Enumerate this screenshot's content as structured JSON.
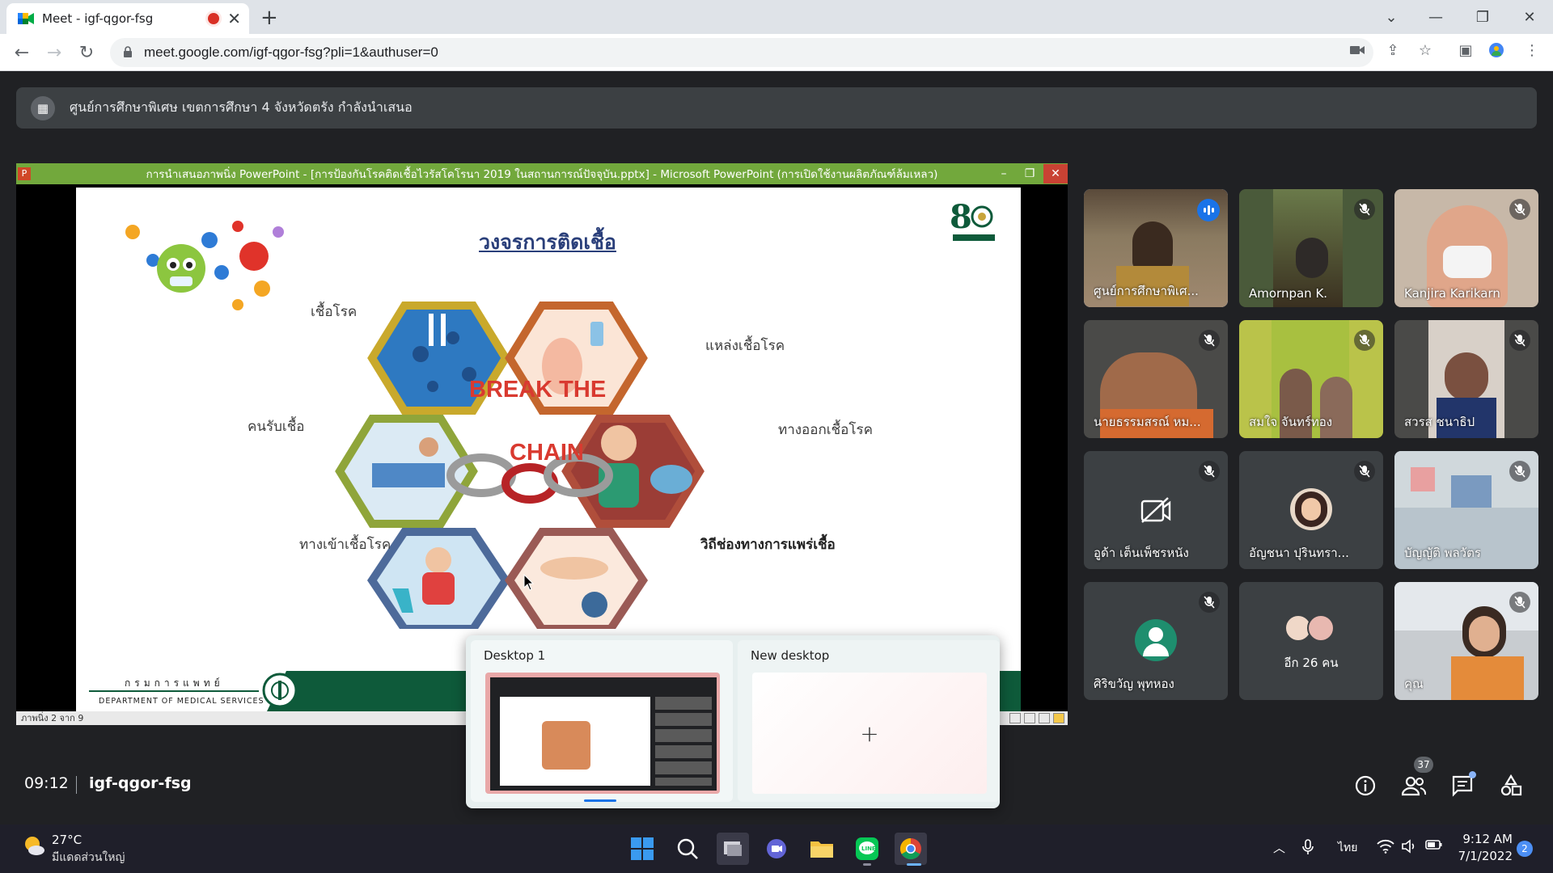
{
  "browser": {
    "tab_title": "Meet - igf-qgor-fsg",
    "url": "meet.google.com/igf-qgor-fsg?pli=1&authuser=0"
  },
  "meet": {
    "presenting_text": "ศูนย์การศึกษาพิเศษ เขตการศึกษา 4 จังหวัดตรัง กำลังนำเสนอ",
    "time": "09:12",
    "meeting_code": "igf-qgor-fsg",
    "participant_count": "37",
    "participants": [
      {
        "name": "ศูนย์การศึกษาพิเศ...",
        "muted": false,
        "speaking": true
      },
      {
        "name": "Amornpan K.",
        "muted": true
      },
      {
        "name": "Kanjira Karikarn",
        "muted": true
      },
      {
        "name": "นายธรรมสรณ์ หม...",
        "muted": true
      },
      {
        "name": "สมใจ จันทร์ทอง",
        "muted": true
      },
      {
        "name": "สวรส ชนาธิป",
        "muted": true
      },
      {
        "name": "อูด้า เต็นเพ็ชรหนัง",
        "muted": true
      },
      {
        "name": "อัญชนา ปุรินทรา...",
        "muted": true
      },
      {
        "name": "บัญญัติ พลวัตร",
        "muted": true
      },
      {
        "name": "ศิริขวัญ พุทหอง",
        "muted": true
      },
      {
        "name": "อีก 26 คน",
        "muted": false
      },
      {
        "name": "คุณ",
        "muted": true
      }
    ]
  },
  "powerpoint": {
    "window_title": "การนำเสนอภาพนิ่ง PowerPoint - [การป้องกันโรคติดเชื้อไวรัสโคโรนา 2019 ในสถานการณ์ปัจจุบัน.pptx] - Microsoft PowerPoint (การเปิดใช้งานผลิตภัณฑ์ล้มเหลว)",
    "status": "ภาพนิ่ง 2 จาก 9",
    "slide": {
      "title": "วงจรการติดเชื้อ",
      "center_text_1": "BREAK THE",
      "center_text_2": "CHAIN",
      "labels": {
        "pathogen": "เชื้อโรค",
        "reservoir": "แหล่งเชื้อโรค",
        "host": "คนรับเชื้อ",
        "exit": "ทางออกเชื้อโรค",
        "entry": "ทางเข้าเชื้อโรค",
        "transmission": "วิถีช่องทางการแพร่เชื้อ"
      },
      "logo_text": "กรมการแพทย์",
      "footer_th": "กรมการแพทย์",
      "footer_en": "DEPARTMENT OF MEDICAL SERVICES"
    }
  },
  "taskview": {
    "desktop1": "Desktop 1",
    "new_desktop": "New desktop"
  },
  "taskbar": {
    "temp": "27°C",
    "weather": "มีแดดส่วนใหญ่",
    "lang": "ไทย",
    "time": "9:12 AM",
    "date": "7/1/2022",
    "notifications": "2"
  }
}
